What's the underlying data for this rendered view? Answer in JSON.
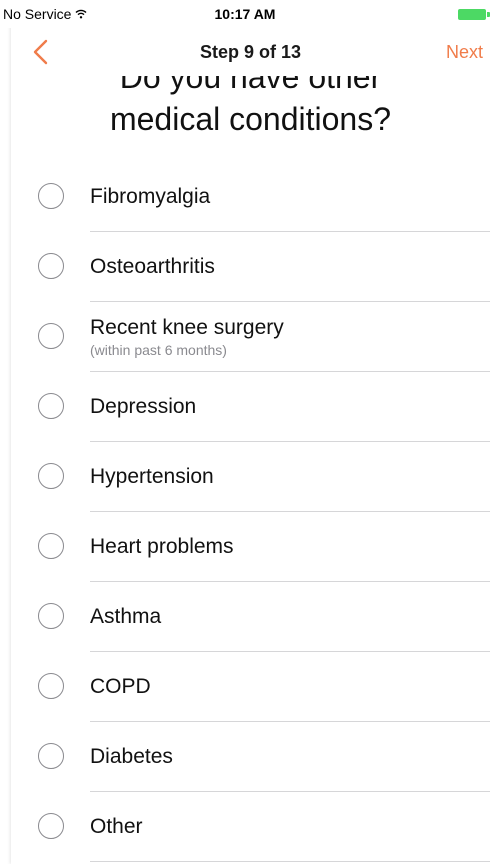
{
  "status_bar": {
    "carrier": "No Service",
    "time": "10:17 AM"
  },
  "nav": {
    "title": "Step 9 of 13",
    "next_label": "Next",
    "accent_color": "#f07c4a"
  },
  "question": {
    "line1": "Do you have other",
    "line2": "medical conditions?"
  },
  "options": [
    {
      "label": "Fibromyalgia",
      "sub": ""
    },
    {
      "label": "Osteoarthritis",
      "sub": ""
    },
    {
      "label": "Recent knee surgery",
      "sub": "(within past 6 months)"
    },
    {
      "label": "Depression",
      "sub": ""
    },
    {
      "label": "Hypertension",
      "sub": ""
    },
    {
      "label": "Heart problems",
      "sub": ""
    },
    {
      "label": "Asthma",
      "sub": ""
    },
    {
      "label": "COPD",
      "sub": ""
    },
    {
      "label": "Diabetes",
      "sub": ""
    },
    {
      "label": "Other",
      "sub": ""
    }
  ]
}
